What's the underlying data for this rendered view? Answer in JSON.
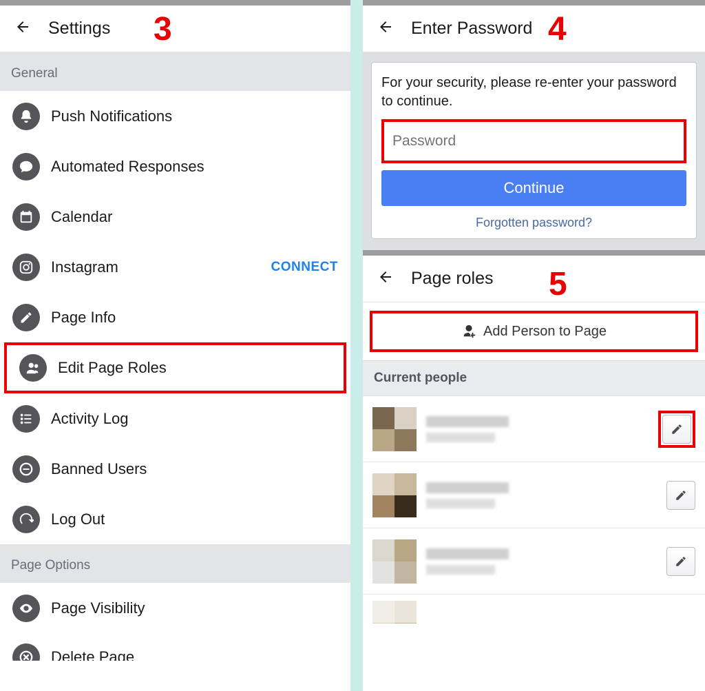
{
  "steps": {
    "left": "3",
    "right_top": "4",
    "right_bottom": "5"
  },
  "left": {
    "header_title": "Settings",
    "sections": {
      "general_label": "General",
      "page_options_label": "Page Options"
    },
    "items": {
      "push": {
        "label": "Push Notifications"
      },
      "auto": {
        "label": "Automated Responses"
      },
      "cal": {
        "label": "Calendar"
      },
      "insta": {
        "label": "Instagram",
        "action": "CONNECT"
      },
      "info": {
        "label": "Page Info"
      },
      "roles": {
        "label": "Edit Page Roles"
      },
      "activity": {
        "label": "Activity Log"
      },
      "banned": {
        "label": "Banned Users"
      },
      "logout": {
        "label": "Log Out"
      },
      "visibility": {
        "label": "Page Visibility"
      },
      "delete": {
        "label": "Delete Page"
      }
    }
  },
  "right_top": {
    "header_title": "Enter Password",
    "message": "For your security, please re-enter your password to continue.",
    "password_placeholder": "Password",
    "continue_label": "Continue",
    "forgot_label": "Forgotten password?"
  },
  "right_bottom": {
    "header_title": "Page roles",
    "add_label": "Add Person to Page",
    "current_people_label": "Current people",
    "people_count": 4
  }
}
